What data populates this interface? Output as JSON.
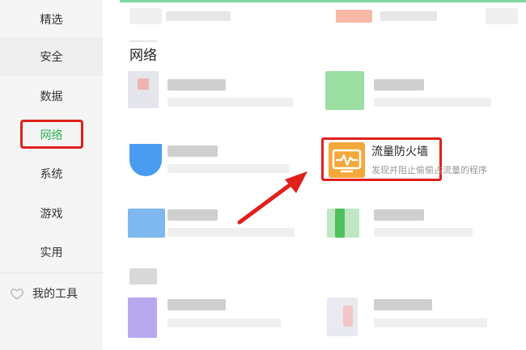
{
  "sidebar": {
    "items": [
      {
        "label": "精选"
      },
      {
        "label": "安全"
      },
      {
        "label": "数据"
      },
      {
        "label": "网络"
      },
      {
        "label": "系统"
      },
      {
        "label": "游戏"
      },
      {
        "label": "实用"
      }
    ],
    "my_tools": "我的工具"
  },
  "main": {
    "section_title": "网络",
    "featured_tool": {
      "name": "流量防火墙",
      "description": "发现并阻止偷偷占流量的程序",
      "icon": "pulse-monitor-icon"
    }
  },
  "colors": {
    "accent_green": "#2fb255",
    "highlight_red": "#e0201b",
    "firewall_orange": "#f5a83a"
  }
}
